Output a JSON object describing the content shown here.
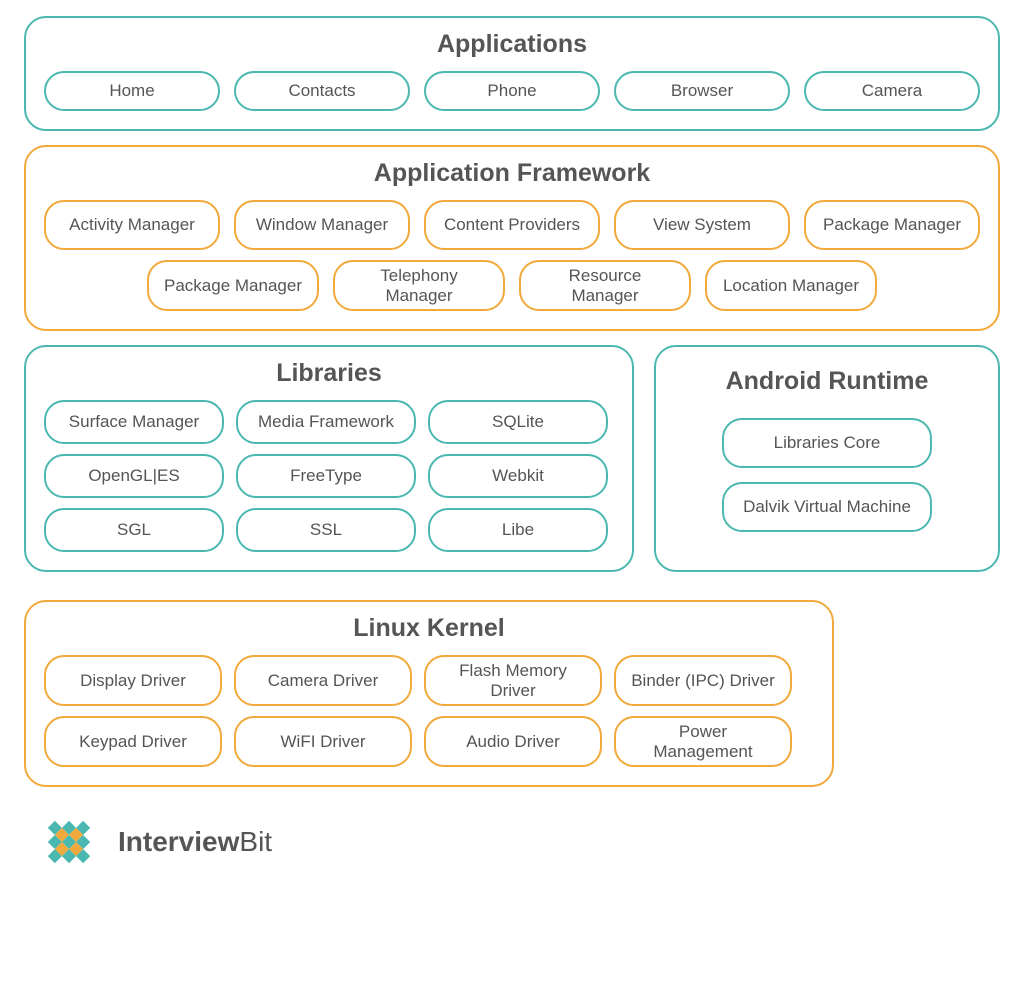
{
  "layers": {
    "applications": {
      "title": "Applications",
      "items": [
        "Home",
        "Contacts",
        "Phone",
        "Browser",
        "Camera"
      ]
    },
    "framework": {
      "title": "Application Framework",
      "row1": [
        "Activity Manager",
        "Window Manager",
        "Content Providers",
        "View System",
        "Package Manager"
      ],
      "row2": [
        "Package Manager",
        "Telephony Manager",
        "Resource Manager",
        "Location Manager"
      ]
    },
    "libraries": {
      "title": "Libraries",
      "row1": [
        "Surface Manager",
        "Media Framework",
        "SQLite"
      ],
      "row2": [
        "OpenGL|ES",
        "FreeType",
        "Webkit"
      ],
      "row3": [
        "SGL",
        "SSL",
        "Libe"
      ]
    },
    "runtime": {
      "title": "Android Runtime",
      "items": [
        "Libraries Core",
        "Dalvik Virtual Machine"
      ]
    },
    "kernel": {
      "title": "Linux Kernel",
      "row1": [
        "Display Driver",
        "Camera Driver",
        "Flash Memory Driver",
        "Binder (IPC) Driver"
      ],
      "row2": [
        "Keypad Driver",
        "WiFI Driver",
        "Audio Driver",
        "Power Management"
      ]
    }
  },
  "logo": {
    "bold": "Interview",
    "light": "Bit"
  }
}
